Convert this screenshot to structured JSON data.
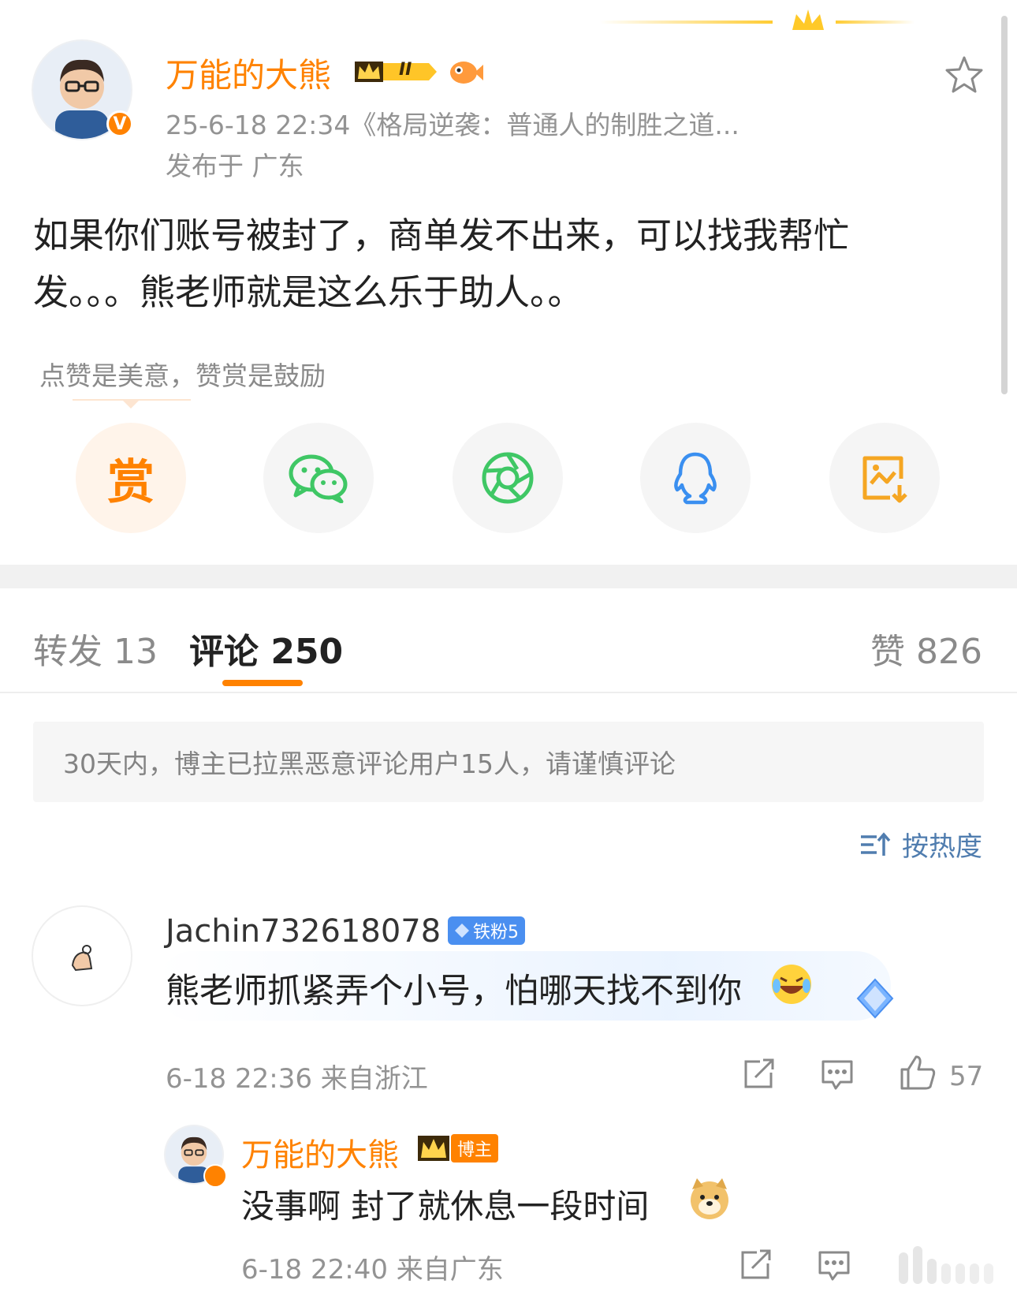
{
  "post": {
    "author": "万能的大熊",
    "level_badge": "II",
    "verified_mark": "V",
    "date_source": "25-6-18 22:34《格局逆袭：普通人的制胜之道...",
    "location": "发布于 广东",
    "content_line1": "如果你们账号被封了，商单发不出来，可以找我帮忙",
    "content_line2": "发。。。熊老师就是这么乐于助人。。"
  },
  "reward": {
    "hint": "点赞是美意，赞赏是鼓励",
    "reward_char": "赏",
    "share_icons": [
      "wechat-icon",
      "moments-icon",
      "qq-icon",
      "save-image-icon"
    ]
  },
  "tabs": {
    "repost": "转发 13",
    "comments": "评论 250",
    "likes": "赞 826"
  },
  "notice": "30天内，博主已拉黑恶意评论用户15人，请谨慎评论",
  "sort_label": "按热度",
  "comments": [
    {
      "user": "Jachin732618078",
      "badge": "铁粉5",
      "text": "熊老师抓紧弄个小号，怕哪天找不到你",
      "time_place": "6-18 22:36 来自浙江",
      "likes": "57"
    }
  ],
  "reply": {
    "user": "万能的大熊",
    "badge": "博主",
    "text": "没事啊 封了就休息一段时间",
    "time_place": "6-18 22:40 来自广东"
  },
  "colors": {
    "accent": "#ff8200",
    "link": "#507daf",
    "wechat": "#3fc765",
    "qq": "#3a8ff0"
  }
}
